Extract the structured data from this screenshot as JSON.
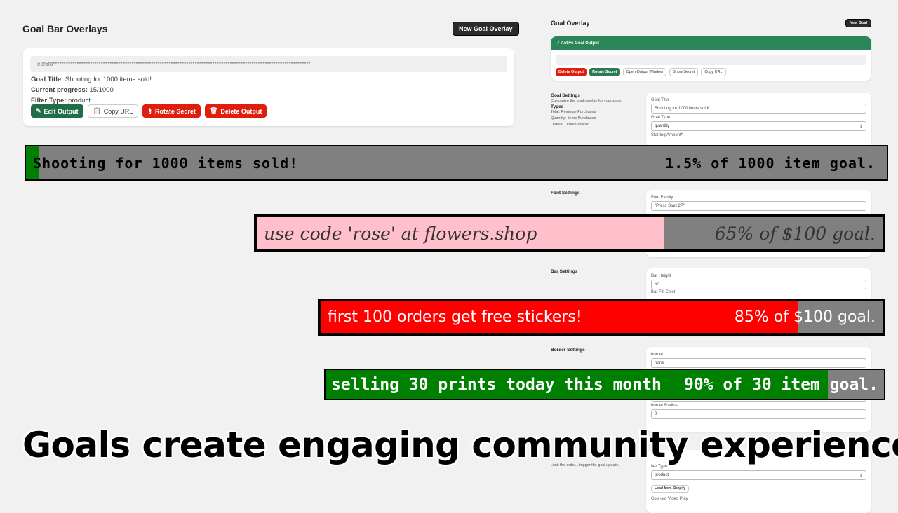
{
  "left": {
    "title": "Goal Bar Overlays",
    "new_button": "New Goal Overlay",
    "secret": "eef6f8**********************************************************************************************************************",
    "goal_title_label": "Goal Title:",
    "goal_title": "Shooting for 1000 items sold!",
    "progress_label": "Current progress:",
    "progress": "15/1000",
    "filter_label": "Filter Type:",
    "filter": "product",
    "buttons": {
      "edit": "Edit Output",
      "copy": "Copy URL",
      "rotate": "Rotate Secret",
      "delete": "Delete Output"
    }
  },
  "right": {
    "title": "Goal Overlay",
    "new_button": "New Goal",
    "active_header": "Active Goal Output",
    "buttons": {
      "delete": "Delete Output",
      "rotate": "Rotate Secret",
      "open": "Open Output Window",
      "show": "Show Secret",
      "copy": "Copy URL"
    },
    "goal_settings": {
      "title": "Goal Settings",
      "desc": "Customize the goal overlay for your store.",
      "types_title": "Types",
      "types": [
        "Total: Revenue Purchased",
        "Quantity: Items Purchased",
        "Orders: Orders Placed"
      ],
      "goal_title_label": "Goal Title",
      "goal_title": "Shooting for 1000 items sold!",
      "goal_type_label": "Goal Type",
      "goal_type": "quantity",
      "starting_label": "Starting Amount*"
    },
    "font_settings": {
      "title": "Font Settings",
      "family_label": "Font Family",
      "family": "\"Press Start 2P\""
    },
    "bar_settings": {
      "title": "Bar Settings",
      "height_label": "Bar Height",
      "height": "50",
      "fill_label": "Bar Fill Color"
    },
    "border_settings": {
      "title": "Border Settings",
      "border_label": "border",
      "border": "none",
      "width": "2",
      "radius_label": "border Radius",
      "radius": "0"
    },
    "filter_settings": {
      "desc": "Limit the order... trigger the goal update.",
      "type_label": "lter Type",
      "type": "product",
      "load_button": "Load from Shopify",
      "item": "Cool-aid Video Play"
    }
  },
  "bars": [
    {
      "left": "Shooting for 1000 items sold!",
      "right": "1.5% of 1000 item goal.",
      "progress": 1.5,
      "fill": "#008000",
      "bg": "#808080",
      "text_color": "#000000"
    },
    {
      "left": "use code 'rose' at flowers.shop",
      "right": "65% of $100 goal.",
      "progress": 65,
      "fill": "#ffc0cb",
      "bg": "#808080",
      "text_color": "#333333"
    },
    {
      "left": "first 100 orders get free stickers!",
      "right": "85% of $100 goal.",
      "progress": 85,
      "fill": "#ff0000",
      "bg": "#808080",
      "text_color": "#ffffff"
    },
    {
      "left": "selling 30 prints today this month",
      "right": "90% of 30 item goal.",
      "progress": 90,
      "fill": "#008000",
      "bg": "#808080",
      "text_color": "#ffffff"
    }
  ],
  "caption": "Goals create engaging community experiences"
}
